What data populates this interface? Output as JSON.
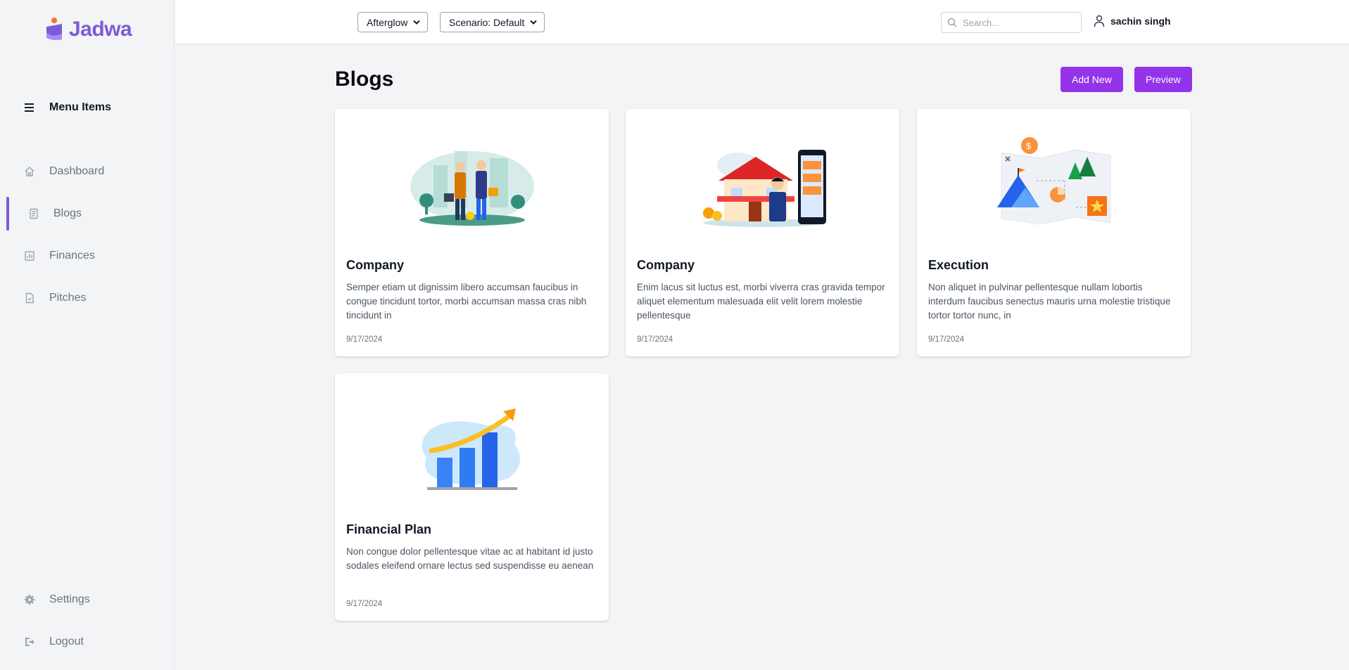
{
  "brand": {
    "name": "Jadwa",
    "accent": "#7c5cd6",
    "button_color": "#9333ea"
  },
  "sidebar": {
    "menu_title": "Menu Items",
    "items": [
      {
        "label": "Dashboard",
        "icon": "home-icon"
      },
      {
        "label": "Blogs",
        "icon": "document-icon",
        "active": true
      },
      {
        "label": "Finances",
        "icon": "chart-icon"
      },
      {
        "label": "Pitches",
        "icon": "file-icon"
      }
    ],
    "bottom": [
      {
        "label": "Settings",
        "icon": "gear-icon"
      },
      {
        "label": "Logout",
        "icon": "logout-icon"
      }
    ]
  },
  "topbar": {
    "theme_select": "Afterglow",
    "scenario_select": "Scenario: Default",
    "search_placeholder": "Search...",
    "user_name": "sachin singh"
  },
  "main": {
    "title": "Blogs",
    "add_new": "Add New",
    "preview": "Preview",
    "posts": [
      {
        "title": "Company",
        "description": "Semper etiam ut dignissim libero accumsan faucibus in congue tincidunt tortor, morbi accumsan massa cras nibh tincidunt in",
        "date": "9/17/2024",
        "image": "business-handshake-illustration"
      },
      {
        "title": "Company",
        "description": "Enim lacus sit luctus est, morbi viverra cras gravida tempor aliquet elementum malesuada elit velit lorem molestie pellentesque",
        "date": "9/17/2024",
        "image": "house-and-phone-illustration"
      },
      {
        "title": "Execution",
        "description": "Non aliquet in pulvinar pellentesque nullam lobortis interdum faucibus senectus mauris urna molestie tristique tortor tortor nunc, in",
        "date": "9/17/2024",
        "image": "roadmap-illustration"
      },
      {
        "title": "Financial Plan",
        "description": "Non congue dolor pellentesque vitae ac at habitant id justo sodales eleifend ornare lectus sed suspendisse eu aenean",
        "date": "9/17/2024",
        "image": "growth-chart-illustration"
      }
    ]
  }
}
